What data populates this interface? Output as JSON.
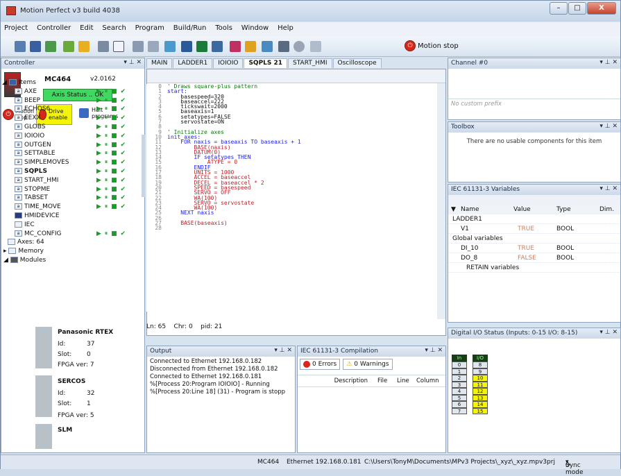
{
  "app": {
    "title": "Motion Perfect v3 build 4038",
    "min": "–",
    "max": "□",
    "close": "X"
  },
  "menu": [
    "Project",
    "Controller",
    "Edit",
    "Search",
    "Program",
    "Build/Run",
    "Tools",
    "Window",
    "Help"
  ],
  "toolbar": {
    "motion_stop": "Motion stop"
  },
  "controller": {
    "title": "Controller",
    "model": "MC464",
    "version": "v2.0162",
    "axis_status": "Axis Status .. OK",
    "motion_stop": "Motion stop",
    "drive_enable": "Drive enable",
    "halt": "Halt programs"
  },
  "tree": {
    "items_label": "Items",
    "items": [
      "AXE",
      "BEEP",
      "ECHOS6",
      "EEXX",
      "GLOBS",
      "IOIOIO",
      "OUTGEN",
      "SETTABLE",
      "SIMPLEMOVES",
      "SQPLS",
      "START_HMI",
      "STOPME",
      "TABSET",
      "TIME_MOVE"
    ],
    "hmidevice": "HMIDEVICE",
    "iec": "IEC",
    "mc_config": "MC_CONFIG",
    "axes": "Axes: 64",
    "memory": "Memory",
    "modules": "Modules"
  },
  "modules": [
    {
      "name": "Panasonic RTEX",
      "id": "37",
      "slot": "0",
      "fpga": "FPGA ver: 7"
    },
    {
      "name": "SERCOS",
      "id": "32",
      "slot": "1",
      "fpga": "FPGA ver: 5"
    },
    {
      "name": "SLM",
      "id": "",
      "slot": "",
      "fpga": ""
    }
  ],
  "module_labels": {
    "id": "Id:",
    "slot": "Slot:"
  },
  "tabs": [
    "MAIN",
    "LADDER1",
    "IOIOIO",
    "SQPLS 21",
    "START_HMI",
    "Oscilloscope"
  ],
  "code": [
    [
      "0",
      "' Draws square-plus pattern",
      "cm"
    ],
    [
      "1",
      "start:",
      "kw"
    ],
    [
      "2",
      "    basespeed=320",
      ""
    ],
    [
      "3",
      "    baseaccel=222",
      ""
    ],
    [
      "4",
      "    tickswait=2000",
      ""
    ],
    [
      "5",
      "    baseaxis=1",
      ""
    ],
    [
      "6",
      "    setatypes=FALSE",
      ""
    ],
    [
      "7",
      "    servostate=ON",
      ""
    ],
    [
      "8",
      "",
      ""
    ],
    [
      "9",
      "' Initialize axes",
      "cm"
    ],
    [
      "10",
      "init_axes:",
      "kw"
    ],
    [
      "11",
      "    FOR naxis = baseaxis TO baseaxis + 1",
      "kw"
    ],
    [
      "12",
      "        BASE(naxis)",
      "rd"
    ],
    [
      "13",
      "        DATUM(0)",
      "rd"
    ],
    [
      "14",
      "        IF setatypes THEN",
      "kw"
    ],
    [
      "15",
      "            ATYPE = 0",
      "rd"
    ],
    [
      "16",
      "        ENDIF",
      "kw"
    ],
    [
      "17",
      "        UNITS = 1000",
      "rd"
    ],
    [
      "18",
      "        ACCEL = baseaccel",
      "rd"
    ],
    [
      "19",
      "        DECEL = baseaccel * 2",
      "rd"
    ],
    [
      "20",
      "        SPEED = basespeed",
      "rd"
    ],
    [
      "21",
      "        SERVO = OFF",
      "rd"
    ],
    [
      "22",
      "        WA(100)",
      "rd"
    ],
    [
      "23",
      "        SERVO = servostate",
      "rd"
    ],
    [
      "24",
      "        WA(100)",
      "rd"
    ],
    [
      "25",
      "    NEXT naxis",
      "kw"
    ],
    [
      "26",
      "",
      ""
    ],
    [
      "27",
      "    BASE(baseaxis)",
      "rd"
    ],
    [
      "28",
      "",
      ""
    ]
  ],
  "editor_status": {
    "line": "Ln:  65",
    "chr": "Chr:  0",
    "pid": "pid:  21"
  },
  "output": {
    "title": "Output",
    "lines": [
      "Connected to Ethernet 192.168.0.182",
      "Disconnected from Ethernet 192.168.0.182",
      "Connected to Ethernet 192.168.0.181",
      "%[Process 20:Program IOIOIO] - Running",
      "%[Process 20:Line 18] (31) - Program is stopp"
    ]
  },
  "compile": {
    "title": "IEC 61131-3 Compilation",
    "errors": "0 Errors",
    "warnings": "0 Warnings",
    "cols": [
      "Description",
      "File",
      "Line",
      "Column"
    ]
  },
  "channel": {
    "title": "Channel #0",
    "placeholder": "No custom prefix"
  },
  "toolbox": {
    "title": "Toolbox",
    "msg": "There are no usable components for this item"
  },
  "iecvars": {
    "title": "IEC 61131-3 Variables",
    "cols": [
      "Name",
      "Value",
      "Type",
      "Dim."
    ],
    "rows": [
      {
        "n": "LADDER1",
        "v": "",
        "t": ""
      },
      {
        "n": "V1",
        "v": "TRUE",
        "t": "BOOL"
      },
      {
        "n": "Global variables",
        "v": "",
        "t": ""
      },
      {
        "n": "DI_10",
        "v": "TRUE",
        "t": "BOOL"
      },
      {
        "n": "DO_8",
        "v": "FALSE",
        "t": "BOOL"
      },
      {
        "n": "RETAIN variables",
        "v": "",
        "t": ""
      }
    ]
  },
  "dio": {
    "title": "Digital I/O Status (Inputs: 0-15  I/O: 8-15)",
    "h_in": "In",
    "h_io": "I/O",
    "inputs": [
      "0",
      "1",
      "2",
      "3",
      "4",
      "5",
      "6",
      "7"
    ],
    "ios": [
      "8",
      "9",
      "10",
      "11",
      "12",
      "13",
      "14",
      "15"
    ],
    "active_io": [
      false,
      false,
      true,
      true,
      true,
      true,
      true,
      true
    ]
  },
  "status": {
    "model": "MC464",
    "conn": "Ethernet 192.168.0.181",
    "path": "C:\\Users\\TonyM\\Documents\\MPv3 Projects\\_xyz\\_xyz.mpv3prj",
    "sync": "Sync mode"
  },
  "colors": {
    "green": "#1c9a2a",
    "active_io": "#f4f40a",
    "axis_ok": "#40d860"
  }
}
